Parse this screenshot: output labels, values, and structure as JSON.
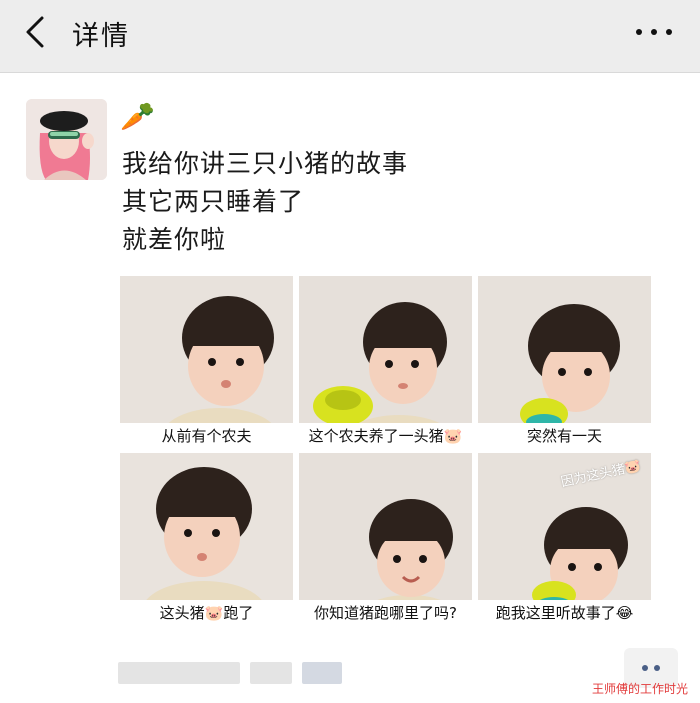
{
  "navbar": {
    "title": "详情",
    "back_icon": "chevron-left-icon",
    "more_icon": "more-dots-icon"
  },
  "post": {
    "username": "🥕",
    "text_lines": [
      "我给你讲三只小猪的故事",
      "其它两只睡着了",
      "就差你啦"
    ],
    "images": [
      {
        "caption": "从前有个农夫"
      },
      {
        "caption": "这个农夫养了一头猪🐷"
      },
      {
        "caption": "突然有一天"
      },
      {
        "caption": "这头猪🐷跑了"
      },
      {
        "caption": "你知道猪跑哪里了吗?"
      },
      {
        "caption": "跑我这里听故事了😂",
        "overlay": "因为这头猪🐷"
      }
    ]
  },
  "footer": {
    "comment_icon": "comment-dots-icon",
    "watermark": "王师傅的工作时光"
  },
  "colors": {
    "navbar_bg": "#ededed",
    "link_blue": "#4a5f86",
    "watermark_red": "#e23b3b"
  }
}
